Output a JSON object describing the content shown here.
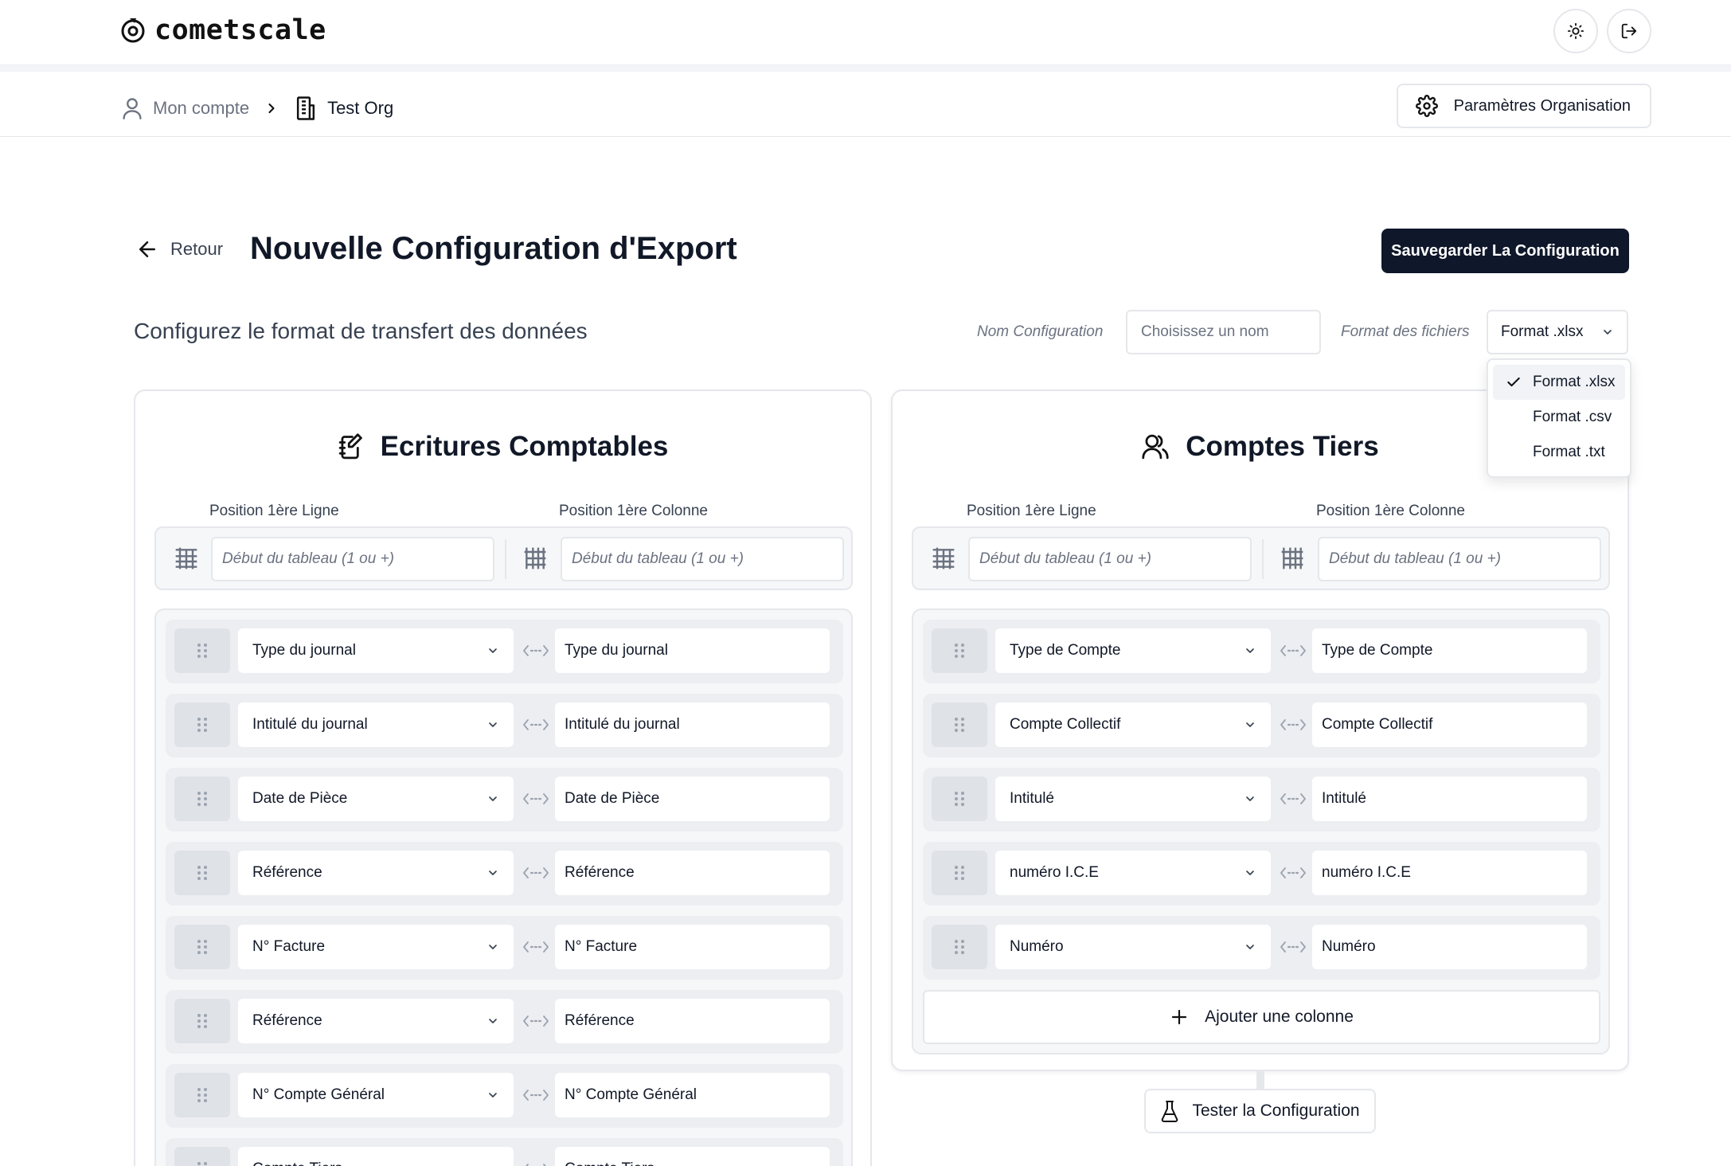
{
  "app": {
    "logo_text": "cometscale"
  },
  "breadcrumb": {
    "account": "Mon compte",
    "org": "Test Org"
  },
  "header": {
    "org_settings_label": "Paramètres Organisation"
  },
  "page": {
    "back_label": "Retour",
    "title": "Nouvelle Configuration d'Export",
    "save_label": "Sauvegarder La Configuration",
    "subtitle": "Configurez le format de transfert des données"
  },
  "config": {
    "name_label": "Nom Configuration",
    "name_placeholder": "Choisissez un nom",
    "format_label": "Format des fichiers",
    "format_selected": "Format .xlsx",
    "format_options": [
      "Format .xlsx",
      "Format .csv",
      "Format .txt"
    ]
  },
  "left_card": {
    "title": "Ecritures Comptables",
    "first_row_label": "Position 1ère Ligne",
    "first_col_label": "Position 1ère Colonne",
    "first_row_placeholder": "Début du tableau (1 ou +)",
    "first_col_placeholder": "Début du tableau (1 ou +)",
    "rows": [
      {
        "source": "Type du journal",
        "target": "Type du journal"
      },
      {
        "source": "Intitulé du journal",
        "target": "Intitulé du journal"
      },
      {
        "source": "Date de Pièce",
        "target": "Date de Pièce"
      },
      {
        "source": "Référence",
        "target": "Référence"
      },
      {
        "source": "N° Facture",
        "target": "N° Facture"
      },
      {
        "source": "Référence",
        "target": "Référence"
      },
      {
        "source": "N° Compte Général",
        "target": "N° Compte Général"
      },
      {
        "source": "Compte Tiers",
        "target": "Compte Tiers"
      }
    ]
  },
  "right_card": {
    "title": "Comptes Tiers",
    "first_row_label": "Position 1ère Ligne",
    "first_col_label": "Position 1ère Colonne",
    "first_row_placeholder": "Début du tableau (1 ou +)",
    "first_col_placeholder": "Début du tableau (1 ou +)",
    "rows": [
      {
        "source": "Type de Compte",
        "target": "Type de Compte"
      },
      {
        "source": "Compte Collectif",
        "target": "Compte Collectif"
      },
      {
        "source": "Intitulé",
        "target": "Intitulé"
      },
      {
        "source": "numéro I.C.E",
        "target": "numéro I.C.E"
      },
      {
        "source": "Numéro",
        "target": "Numéro"
      }
    ],
    "add_column_label": "Ajouter une colonne"
  },
  "test_label": "Tester la Configuration",
  "colors": {
    "primary": "#0f172a",
    "border": "#e5e7eb",
    "muted_bg": "#f6f7f9"
  }
}
